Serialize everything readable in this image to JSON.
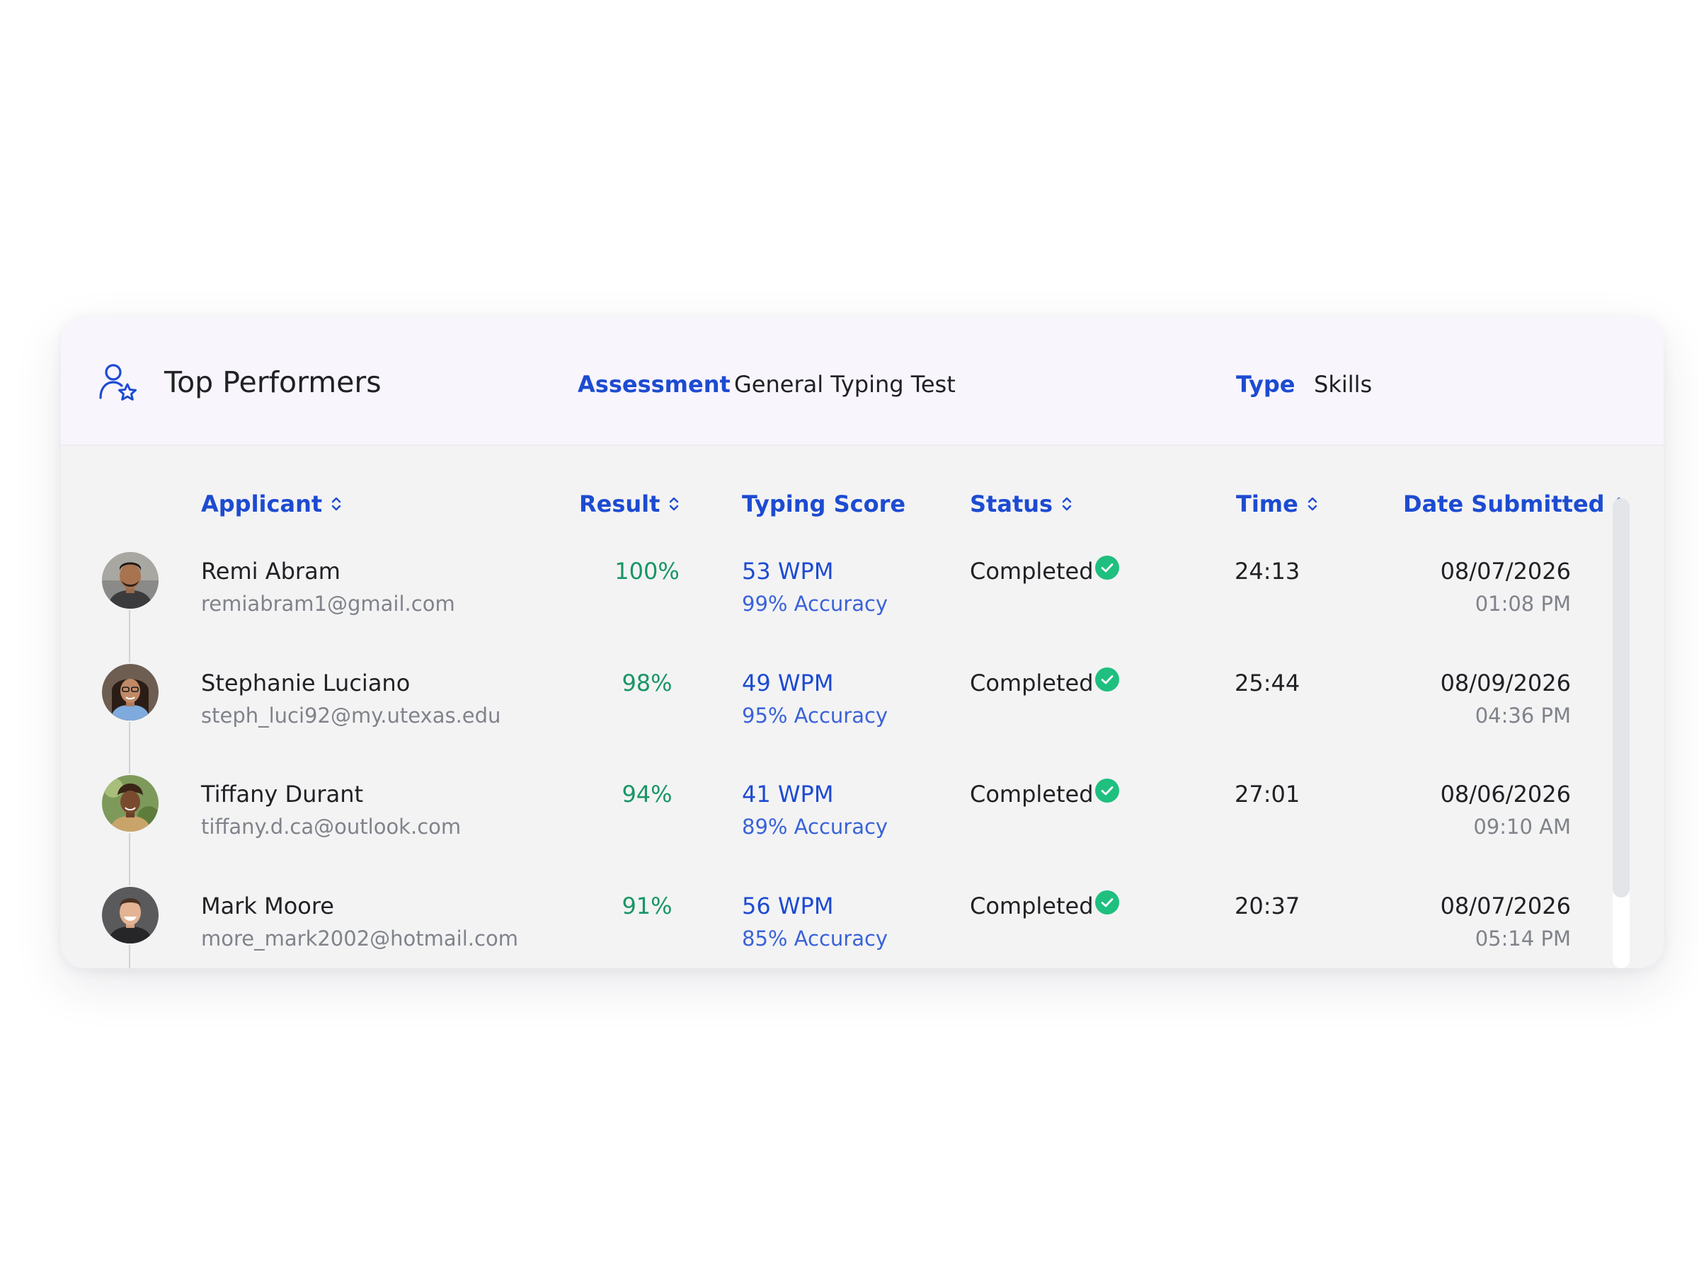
{
  "header": {
    "title": "Top Performers",
    "assessment_label": "Assessment",
    "assessment_value": "General Typing Test",
    "type_label": "Type",
    "type_value": "Skills"
  },
  "columns": {
    "applicant": "Applicant",
    "result": "Result",
    "typing_score": "Typing Score",
    "status": "Status",
    "time": "Time",
    "date_submitted": "Date Submitted"
  },
  "rows": [
    {
      "name": "Remi Abram",
      "email": "remiabram1@gmail.com",
      "result": "100%",
      "wpm": "53 WPM",
      "accuracy": "99% Accuracy",
      "status": "Completed",
      "time": "24:13",
      "date": "08/07/2026",
      "clock": "01:08 PM"
    },
    {
      "name": "Stephanie Luciano",
      "email": "steph_luci92@my.utexas.edu",
      "result": "98%",
      "wpm": "49 WPM",
      "accuracy": "95% Accuracy",
      "status": "Completed",
      "time": "25:44",
      "date": "08/09/2026",
      "clock": "04:36 PM"
    },
    {
      "name": "Tiffany Durant",
      "email": "tiffany.d.ca@outlook.com",
      "result": "94%",
      "wpm": "41 WPM",
      "accuracy": "89% Accuracy",
      "status": "Completed",
      "time": "27:01",
      "date": "08/06/2026",
      "clock": "09:10 AM"
    },
    {
      "name": "Mark Moore",
      "email": "more_mark2002@hotmail.com",
      "result": "91%",
      "wpm": "56 WPM",
      "accuracy": "85% Accuracy",
      "status": "Completed",
      "time": "20:37",
      "date": "08/07/2026",
      "clock": "05:14 PM"
    }
  ],
  "icons": {
    "header": "user-star-icon",
    "sort": "sort-arrows-icon",
    "status": "check-circle-icon"
  },
  "colors": {
    "accent": "#1d4bd1",
    "success": "#1fbf7f",
    "result_text": "#199664",
    "header_bg": "#f8f5fd",
    "table_bg": "#f3f3f4"
  }
}
